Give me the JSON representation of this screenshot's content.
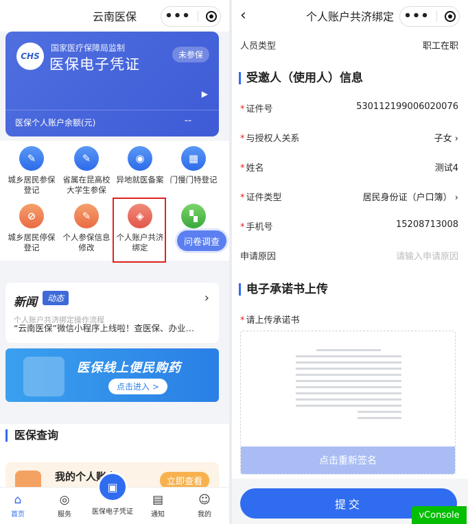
{
  "left": {
    "nav_title": "云南医保",
    "card": {
      "logo_text": "CHS",
      "supervisor": "国家医疗保障局监制",
      "title": "医保电子凭证",
      "status_badge": "未参保",
      "balance_label": "医保个人账户余额(元)",
      "balance_value": "--"
    },
    "services": [
      {
        "label": "城乡居民参保登记",
        "icon": "edit-doc-icon",
        "color": "blue"
      },
      {
        "label": "省属在昆高校大学生参保",
        "icon": "edit-doc-icon",
        "color": "blue"
      },
      {
        "label": "异地就医备案",
        "icon": "location-pin-icon",
        "color": "blue"
      },
      {
        "label": "门慢门特登记",
        "icon": "calendar-icon",
        "color": "blue"
      },
      {
        "label": "城乡居民停保登记",
        "icon": "stop-doc-icon",
        "color": "orange"
      },
      {
        "label": "个人参保信息修改",
        "icon": "edit-doc-icon",
        "color": "orange"
      },
      {
        "label": "个人账户共济绑定",
        "icon": "bind-account-icon",
        "color": "red"
      },
      {
        "label": "",
        "icon": "apps-grid-icon",
        "color": "green"
      }
    ],
    "survey_label": "问卷调查",
    "news": {
      "heading": "新闻",
      "tag": "动态",
      "line1": "个人账户共济绑定操作流程",
      "line2": "“云南医保”微信小程序上线啦！查医保、办业…"
    },
    "banner": {
      "title": "医保线上便民购药",
      "button": "点击进入 >"
    },
    "query": {
      "title": "医保查询",
      "card_text": "我的个人账户",
      "button": "立即查看"
    },
    "tabs": [
      {
        "label": "首页",
        "icon": "home-icon"
      },
      {
        "label": "服务",
        "icon": "compass-icon"
      },
      {
        "label": "医保电子凭证",
        "icon": "qr-code-icon"
      },
      {
        "label": "通知",
        "icon": "notice-icon"
      },
      {
        "label": "我的",
        "icon": "user-icon"
      }
    ]
  },
  "right": {
    "nav_title": "个人账户共济绑定",
    "person_type_label": "人员类型",
    "person_type_value": "职工在职",
    "section_invitee": "受邀人（使用人）信息",
    "fields": [
      {
        "label": "证件号",
        "value": "530112199006020076",
        "required": true,
        "arrow": false
      },
      {
        "label": "与授权人关系",
        "value": "子女",
        "required": true,
        "arrow": true
      },
      {
        "label": "姓名",
        "value": "测试4",
        "required": true,
        "arrow": false
      },
      {
        "label": "证件类型",
        "value": "居民身份证（户口簿）",
        "required": true,
        "arrow": true
      },
      {
        "label": "手机号",
        "value": "15208713008",
        "required": true,
        "arrow": false
      }
    ],
    "reason_label": "申请原因",
    "reason_placeholder": "请输入申请原因",
    "section_upload": "电子承诺书上传",
    "upload_label": "请上传承诺书",
    "resign_button": "点击重新签名",
    "submit_button": "提交",
    "vconsole": "vConsole"
  }
}
